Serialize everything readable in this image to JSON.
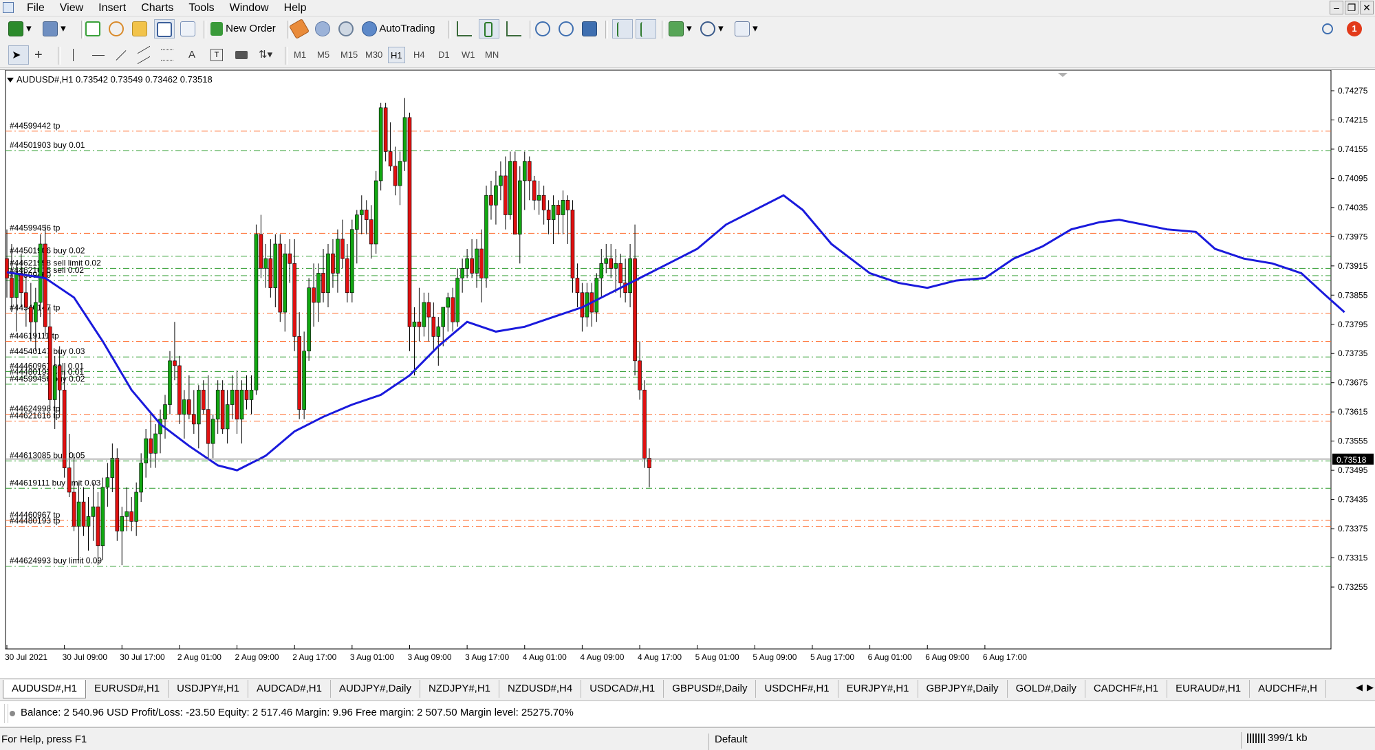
{
  "menu": [
    "File",
    "View",
    "Insert",
    "Charts",
    "Tools",
    "Window",
    "Help"
  ],
  "toolbar": {
    "new_order": "New Order",
    "autotrading": "AutoTrading"
  },
  "timeframes": [
    "M1",
    "M5",
    "M15",
    "M30",
    "H1",
    "H4",
    "D1",
    "W1",
    "MN"
  ],
  "active_timeframe": "H1",
  "notification_count": "1",
  "chart_header": "AUDUSD#,H1  0.73542 0.73549 0.73462 0.73518",
  "colors": {
    "bull": "#11a711",
    "bear": "#e01010",
    "ma": "#1a1adc",
    "tp_line": "#ff6a2a",
    "order_line": "#2a9a2a"
  },
  "chart_data": {
    "type": "candlestick",
    "symbol": "AUDUSD#",
    "timeframe": "H1",
    "ylim": [
      0.73255,
      0.74305
    ],
    "yticks": [
      "0.74275",
      "0.74215",
      "0.74155",
      "0.74095",
      "0.74035",
      "0.73975",
      "0.73915",
      "0.73855",
      "0.73795",
      "0.73735",
      "0.73675",
      "0.73615",
      "0.73555",
      "0.73495",
      "0.73435",
      "0.73375",
      "0.73315",
      "0.73255"
    ],
    "last_price": "0.73518",
    "xticks": [
      "30 Jul 2021",
      "30 Jul 09:00",
      "30 Jul 17:00",
      "2 Aug 01:00",
      "2 Aug 09:00",
      "2 Aug 17:00",
      "3 Aug 01:00",
      "3 Aug 09:00",
      "3 Aug 17:00",
      "4 Aug 01:00",
      "4 Aug 09:00",
      "4 Aug 17:00",
      "5 Aug 01:00",
      "5 Aug 09:00",
      "5 Aug 17:00",
      "6 Aug 01:00",
      "6 Aug 09:00",
      "6 Aug 17:00"
    ],
    "candles": [
      [
        0.7393,
        0.7399,
        0.7385,
        0.7389
      ],
      [
        0.7389,
        0.7396,
        0.7382,
        0.7385
      ],
      [
        0.7385,
        0.7392,
        0.7378,
        0.739
      ],
      [
        0.739,
        0.7394,
        0.7383,
        0.7386
      ],
      [
        0.7386,
        0.739,
        0.7379,
        0.7383
      ],
      [
        0.7383,
        0.7388,
        0.7376,
        0.738
      ],
      [
        0.738,
        0.7387,
        0.7374,
        0.7384
      ],
      [
        0.7384,
        0.7398,
        0.7381,
        0.7396
      ],
      [
        0.7396,
        0.74,
        0.7377,
        0.7379
      ],
      [
        0.7379,
        0.7383,
        0.7362,
        0.7364
      ],
      [
        0.7364,
        0.7373,
        0.7358,
        0.7371
      ],
      [
        0.7371,
        0.7375,
        0.7361,
        0.7366
      ],
      [
        0.7366,
        0.737,
        0.7348,
        0.735
      ],
      [
        0.735,
        0.7357,
        0.7344,
        0.7345
      ],
      [
        0.7345,
        0.7353,
        0.7337,
        0.7338
      ],
      [
        0.7338,
        0.7347,
        0.7331,
        0.7343
      ],
      [
        0.7343,
        0.7346,
        0.7336,
        0.7338
      ],
      [
        0.7338,
        0.7344,
        0.7333,
        0.734
      ],
      [
        0.734,
        0.7347,
        0.7335,
        0.7342
      ],
      [
        0.7342,
        0.7345,
        0.733,
        0.7334
      ],
      [
        0.7334,
        0.7348,
        0.7331,
        0.7346
      ],
      [
        0.7346,
        0.7351,
        0.7342,
        0.7348
      ],
      [
        0.7348,
        0.7355,
        0.7345,
        0.7352
      ],
      [
        0.7352,
        0.7354,
        0.7335,
        0.7337
      ],
      [
        0.7337,
        0.7342,
        0.733,
        0.734
      ],
      [
        0.734,
        0.7346,
        0.7337,
        0.7341
      ],
      [
        0.7341,
        0.7344,
        0.7337,
        0.7339
      ],
      [
        0.7339,
        0.7347,
        0.7336,
        0.7345
      ],
      [
        0.7345,
        0.7353,
        0.7343,
        0.7351
      ],
      [
        0.7351,
        0.7358,
        0.7348,
        0.7356
      ],
      [
        0.7356,
        0.7361,
        0.735,
        0.7353
      ],
      [
        0.7353,
        0.7359,
        0.735,
        0.7357
      ],
      [
        0.7357,
        0.7362,
        0.7353,
        0.736
      ],
      [
        0.736,
        0.7365,
        0.7356,
        0.7363
      ],
      [
        0.7363,
        0.7374,
        0.7361,
        0.7372
      ],
      [
        0.7372,
        0.738,
        0.7368,
        0.7371
      ],
      [
        0.7371,
        0.7373,
        0.7359,
        0.7361
      ],
      [
        0.7361,
        0.7366,
        0.7356,
        0.7364
      ],
      [
        0.7364,
        0.7369,
        0.736,
        0.7361
      ],
      [
        0.7361,
        0.7366,
        0.7357,
        0.7359
      ],
      [
        0.7359,
        0.7367,
        0.7354,
        0.7366
      ],
      [
        0.7366,
        0.7368,
        0.7361,
        0.7362
      ],
      [
        0.7362,
        0.7369,
        0.7352,
        0.7355
      ],
      [
        0.7355,
        0.7361,
        0.7352,
        0.736
      ],
      [
        0.736,
        0.7368,
        0.7357,
        0.7366
      ],
      [
        0.7366,
        0.7368,
        0.7357,
        0.7358
      ],
      [
        0.7358,
        0.7366,
        0.7355,
        0.7363
      ],
      [
        0.7363,
        0.7369,
        0.736,
        0.7366
      ],
      [
        0.7366,
        0.737,
        0.7357,
        0.736
      ],
      [
        0.736,
        0.7368,
        0.7355,
        0.7366
      ],
      [
        0.7366,
        0.7369,
        0.7362,
        0.7364
      ],
      [
        0.7364,
        0.7369,
        0.7361,
        0.7366
      ],
      [
        0.7366,
        0.74,
        0.7365,
        0.7398
      ],
      [
        0.7398,
        0.7402,
        0.7389,
        0.7391
      ],
      [
        0.7391,
        0.7396,
        0.7387,
        0.7393
      ],
      [
        0.7393,
        0.7397,
        0.7385,
        0.7387
      ],
      [
        0.7387,
        0.7398,
        0.7383,
        0.7396
      ],
      [
        0.7396,
        0.7398,
        0.738,
        0.7382
      ],
      [
        0.7382,
        0.7396,
        0.7378,
        0.7394
      ],
      [
        0.7394,
        0.7397,
        0.7388,
        0.7392
      ],
      [
        0.7392,
        0.7397,
        0.7374,
        0.7377
      ],
      [
        0.7377,
        0.7382,
        0.736,
        0.7362
      ],
      [
        0.7362,
        0.7378,
        0.736,
        0.7374
      ],
      [
        0.7374,
        0.7389,
        0.7372,
        0.7387
      ],
      [
        0.7387,
        0.7392,
        0.7379,
        0.7384
      ],
      [
        0.7384,
        0.7392,
        0.738,
        0.739
      ],
      [
        0.739,
        0.7395,
        0.7384,
        0.7386
      ],
      [
        0.7386,
        0.7396,
        0.7383,
        0.7394
      ],
      [
        0.7394,
        0.7397,
        0.7387,
        0.739
      ],
      [
        0.739,
        0.7399,
        0.7386,
        0.7397
      ],
      [
        0.7397,
        0.7401,
        0.7391,
        0.7393
      ],
      [
        0.7393,
        0.7396,
        0.7384,
        0.7386
      ],
      [
        0.7386,
        0.7401,
        0.7384,
        0.7399
      ],
      [
        0.7399,
        0.7403,
        0.7392,
        0.7402
      ],
      [
        0.7402,
        0.7406,
        0.7398,
        0.7403
      ],
      [
        0.7403,
        0.7405,
        0.7398,
        0.7401
      ],
      [
        0.7401,
        0.7404,
        0.7393,
        0.7396
      ],
      [
        0.7396,
        0.7411,
        0.7394,
        0.7409
      ],
      [
        0.7409,
        0.7425,
        0.7407,
        0.7424
      ],
      [
        0.7424,
        0.7425,
        0.7413,
        0.7415
      ],
      [
        0.7415,
        0.7421,
        0.7411,
        0.7412
      ],
      [
        0.7412,
        0.7416,
        0.7406,
        0.7408
      ],
      [
        0.7408,
        0.7415,
        0.7404,
        0.7413
      ],
      [
        0.7413,
        0.7426,
        0.7411,
        0.7422
      ],
      [
        0.7422,
        0.7423,
        0.7374,
        0.7379
      ],
      [
        0.7379,
        0.7383,
        0.7369,
        0.738
      ],
      [
        0.738,
        0.7387,
        0.7376,
        0.7379
      ],
      [
        0.7379,
        0.7386,
        0.7377,
        0.7384
      ],
      [
        0.7384,
        0.7386,
        0.7376,
        0.7381
      ],
      [
        0.7381,
        0.7384,
        0.7374,
        0.7377
      ],
      [
        0.7377,
        0.7381,
        0.7371,
        0.7379
      ],
      [
        0.7379,
        0.7382,
        0.7375,
        0.7383
      ],
      [
        0.7383,
        0.7386,
        0.7378,
        0.7385
      ],
      [
        0.7385,
        0.7387,
        0.7378,
        0.738
      ],
      [
        0.738,
        0.7391,
        0.7379,
        0.7389
      ],
      [
        0.7389,
        0.7393,
        0.7386,
        0.7391
      ],
      [
        0.7391,
        0.7395,
        0.7389,
        0.7393
      ],
      [
        0.7393,
        0.7397,
        0.7389,
        0.739
      ],
      [
        0.739,
        0.7397,
        0.7387,
        0.7395
      ],
      [
        0.7395,
        0.7399,
        0.7384,
        0.7389
      ],
      [
        0.7389,
        0.7408,
        0.7387,
        0.7406
      ],
      [
        0.7406,
        0.7409,
        0.7401,
        0.7404
      ],
      [
        0.7404,
        0.7411,
        0.74,
        0.7408
      ],
      [
        0.7408,
        0.7413,
        0.7405,
        0.741
      ],
      [
        0.741,
        0.7414,
        0.7399,
        0.7402
      ],
      [
        0.7402,
        0.7415,
        0.7401,
        0.7413
      ],
      [
        0.7413,
        0.7415,
        0.7404,
        0.7398
      ],
      [
        0.7398,
        0.7412,
        0.7392,
        0.7409
      ],
      [
        0.7409,
        0.7415,
        0.7403,
        0.7413
      ],
      [
        0.7413,
        0.7414,
        0.7405,
        0.7409
      ],
      [
        0.7409,
        0.741,
        0.7403,
        0.7405
      ],
      [
        0.7405,
        0.7409,
        0.7402,
        0.7406
      ],
      [
        0.7406,
        0.7408,
        0.74,
        0.7403
      ],
      [
        0.7403,
        0.7405,
        0.7398,
        0.7401
      ],
      [
        0.7401,
        0.7406,
        0.7396,
        0.7404
      ],
      [
        0.7404,
        0.7405,
        0.7398,
        0.7402
      ],
      [
        0.7402,
        0.7407,
        0.7398,
        0.7405
      ],
      [
        0.7405,
        0.7406,
        0.7396,
        0.7403
      ],
      [
        0.7403,
        0.7405,
        0.7386,
        0.7389
      ],
      [
        0.7389,
        0.7392,
        0.7383,
        0.7386
      ],
      [
        0.7386,
        0.7388,
        0.7378,
        0.7381
      ],
      [
        0.7381,
        0.7388,
        0.7379,
        0.7386
      ],
      [
        0.7386,
        0.7388,
        0.7379,
        0.7382
      ],
      [
        0.7382,
        0.739,
        0.738,
        0.7389
      ],
      [
        0.7389,
        0.7395,
        0.7385,
        0.7392
      ],
      [
        0.7392,
        0.7396,
        0.739,
        0.7393
      ],
      [
        0.7393,
        0.7396,
        0.7389,
        0.7391
      ],
      [
        0.7391,
        0.7395,
        0.7386,
        0.7392
      ],
      [
        0.7392,
        0.7394,
        0.7385,
        0.7388
      ],
      [
        0.7388,
        0.7393,
        0.7384,
        0.7386
      ],
      [
        0.7386,
        0.7396,
        0.7383,
        0.7393
      ],
      [
        0.7393,
        0.74,
        0.7369,
        0.7372
      ],
      [
        0.7372,
        0.7376,
        0.7364,
        0.7366
      ],
      [
        0.7366,
        0.7368,
        0.735,
        0.7352
      ],
      [
        0.7352,
        0.7354,
        0.7346,
        0.735
      ]
    ],
    "ma": [
      [
        0,
        0.73902
      ],
      [
        8,
        0.7389
      ],
      [
        14,
        0.7385
      ],
      [
        20,
        0.7376
      ],
      [
        26,
        0.7366
      ],
      [
        32,
        0.7359
      ],
      [
        38,
        0.73545
      ],
      [
        44,
        0.73505
      ],
      [
        48,
        0.73495
      ],
      [
        54,
        0.73525
      ],
      [
        60,
        0.73575
      ],
      [
        66,
        0.73605
      ],
      [
        72,
        0.7363
      ],
      [
        78,
        0.7365
      ],
      [
        84,
        0.7369
      ],
      [
        90,
        0.7375
      ],
      [
        96,
        0.738
      ],
      [
        102,
        0.7378
      ],
      [
        108,
        0.7379
      ],
      [
        114,
        0.7381
      ],
      [
        120,
        0.7383
      ],
      [
        126,
        0.7386
      ],
      [
        132,
        0.7389
      ],
      [
        138,
        0.7392
      ],
      [
        144,
        0.7395
      ],
      [
        150,
        0.74
      ],
      [
        156,
        0.7403
      ],
      [
        162,
        0.7406
      ],
      [
        166,
        0.7403
      ],
      [
        172,
        0.7396
      ],
      [
        180,
        0.739
      ],
      [
        186,
        0.7388
      ],
      [
        192,
        0.7387
      ],
      [
        198,
        0.73885
      ],
      [
        204,
        0.7389
      ],
      [
        210,
        0.7393
      ],
      [
        216,
        0.73955
      ],
      [
        222,
        0.7399
      ],
      [
        228,
        0.74005
      ],
      [
        232,
        0.7401
      ],
      [
        236,
        0.74002
      ],
      [
        242,
        0.7399
      ],
      [
        248,
        0.73985
      ],
      [
        252,
        0.7395
      ],
      [
        258,
        0.7393
      ],
      [
        264,
        0.7392
      ],
      [
        270,
        0.739
      ],
      [
        275,
        0.73855
      ],
      [
        279,
        0.7382
      ]
    ],
    "levels": [
      {
        "label": "#44599442 tp",
        "price": 0.74192,
        "kind": "tp"
      },
      {
        "label": "#44501903 buy 0.01",
        "price": 0.74152,
        "kind": "order"
      },
      {
        "label": "#44599456 tp",
        "price": 0.73982,
        "kind": "tp"
      },
      {
        "label": "#44501906 buy 0.02",
        "price": 0.73935,
        "kind": "order"
      },
      {
        "label": "#44621998 sell limit 0.02",
        "price": 0.7391,
        "kind": "order"
      },
      {
        "label": "#44621616 sell 0.02",
        "price": 0.73895,
        "kind": "order"
      },
      {
        "label": "#44599460",
        "price": 0.73885,
        "kind": "order"
      },
      {
        "label": "#44540147 tp",
        "price": 0.73818,
        "kind": "tp"
      },
      {
        "label": "#44619111 tp",
        "price": 0.7376,
        "kind": "tp"
      },
      {
        "label": "#44540147 buy 0.03",
        "price": 0.73728,
        "kind": "order"
      },
      {
        "label": "#44460967 sell 0.01",
        "price": 0.73698,
        "kind": "order"
      },
      {
        "label": "#44480193 sell 0.01",
        "price": 0.73686,
        "kind": "order"
      },
      {
        "label": "#44599456 buy 0.02",
        "price": 0.73672,
        "kind": "order"
      },
      {
        "label": "#44624998 tp",
        "price": 0.7361,
        "kind": "tp"
      },
      {
        "label": "#44621616 tp",
        "price": 0.73596,
        "kind": "tp"
      },
      {
        "label": "#44613085 buy 0.05",
        "price": 0.73514,
        "kind": "order"
      },
      {
        "label": "#44619111 buy limit 0.03",
        "price": 0.73458,
        "kind": "order"
      },
      {
        "label": "#44460967 tp",
        "price": 0.73392,
        "kind": "tp"
      },
      {
        "label": "#44480193 tp",
        "price": 0.7338,
        "kind": "tp"
      },
      {
        "label": "#44624993 buy limit 0.09",
        "price": 0.73298,
        "kind": "order"
      }
    ]
  },
  "tabs": [
    "AUDUSD#,H1",
    "EURUSD#,H1",
    "USDJPY#,H1",
    "AUDCAD#,H1",
    "AUDJPY#,Daily",
    "NZDJPY#,H1",
    "NZDUSD#,H4",
    "USDCAD#,H1",
    "GBPUSD#,Daily",
    "USDCHF#,H1",
    "EURJPY#,H1",
    "GBPJPY#,Daily",
    "GOLD#,Daily",
    "CADCHF#,H1",
    "EURAUD#,H1",
    "AUDCHF#,H"
  ],
  "account": "Balance: 2 540.96 USD  Profit/Loss: -23.50  Equity: 2 517.46  Margin: 9.96  Free margin: 2 507.50  Margin level: 25275.70%",
  "status": {
    "help": "For Help, press F1",
    "profile": "Default",
    "traffic": "399/1 kb"
  }
}
